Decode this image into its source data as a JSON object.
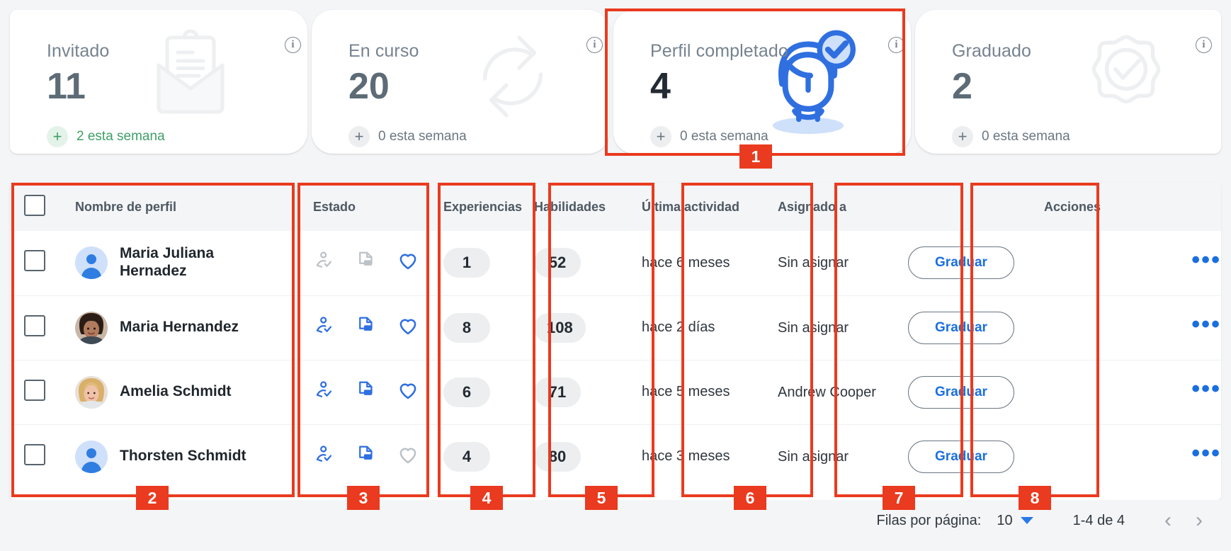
{
  "cards": [
    {
      "title": "Invitado",
      "value": "11",
      "delta_sign": "+",
      "delta": "2 esta semana",
      "info": "i",
      "icon": "clipboard-envelope-icon",
      "accent": "#3f9f67"
    },
    {
      "title": "En curso",
      "value": "20",
      "delta_sign": "+",
      "delta": "0 esta semana",
      "info": "i",
      "icon": "refresh-cycle-icon",
      "accent": "#6b7780"
    },
    {
      "title": "Perfil completado",
      "value": "4",
      "delta_sign": "+",
      "delta": "0 esta semana",
      "info": "i",
      "icon": "profile-check-icon",
      "accent": "#2f7de1"
    },
    {
      "title": "Graduado",
      "value": "2",
      "delta_sign": "+",
      "delta": "0 esta semana",
      "info": "i",
      "icon": "rosette-check-icon",
      "accent": "#6b7780"
    }
  ],
  "table": {
    "headers": {
      "select_all": "",
      "name": "Nombre de perfil",
      "estado": "Estado",
      "experiencias": "Experiencias",
      "habilidades": "Habilidades",
      "ultima_actividad": "Última actividad",
      "asignado_a": "Asignado a",
      "graduar": "",
      "acciones": "Acciones"
    },
    "rows": [
      {
        "name": "Maria Juliana Hernadez",
        "avatar": "placeholder",
        "status": {
          "profile": "off",
          "cv": "off",
          "favorite": "on"
        },
        "experiencias": "1",
        "habilidades": "52",
        "ultima_actividad": "hace 6 meses",
        "asignado_a": "Sin asignar",
        "graduar_label": "Graduar",
        "actions": "•••"
      },
      {
        "name": "Maria Hernandez",
        "avatar": "photo-dark",
        "status": {
          "profile": "on",
          "cv": "on",
          "favorite": "on"
        },
        "experiencias": "8",
        "habilidades": "108",
        "ultima_actividad": "hace 2 días",
        "asignado_a": "Sin asignar",
        "graduar_label": "Graduar",
        "actions": "•••"
      },
      {
        "name": "Amelia Schmidt",
        "avatar": "photo-blonde",
        "status": {
          "profile": "on",
          "cv": "on",
          "favorite": "on"
        },
        "experiencias": "6",
        "habilidades": "71",
        "ultima_actividad": "hace 5 meses",
        "asignado_a": "Andrew Cooper",
        "graduar_label": "Graduar",
        "actions": "•••"
      },
      {
        "name": "Thorsten Schmidt",
        "avatar": "placeholder",
        "status": {
          "profile": "on",
          "cv": "on",
          "favorite": "off"
        },
        "experiencias": "4",
        "habilidades": "80",
        "ultima_actividad": "hace 3 meses",
        "asignado_a": "Sin asignar",
        "graduar_label": "Graduar",
        "actions": "•••"
      }
    ]
  },
  "pagination": {
    "rows_per_page_label": "Filas por página:",
    "rows_per_page_value": "10",
    "range": "1-4 de 4",
    "prev": "‹",
    "next": "›"
  },
  "annotations": [
    {
      "num": "1"
    },
    {
      "num": "2"
    },
    {
      "num": "3"
    },
    {
      "num": "4"
    },
    {
      "num": "5"
    },
    {
      "num": "6"
    },
    {
      "num": "7"
    },
    {
      "num": "8"
    }
  ],
  "colors": {
    "annotation": "#ea3a1f",
    "link": "#1a6fe0",
    "icon_active": "#2f6fe0",
    "icon_inactive": "#bcc2c7",
    "page_bg": "#f4f5f7"
  }
}
